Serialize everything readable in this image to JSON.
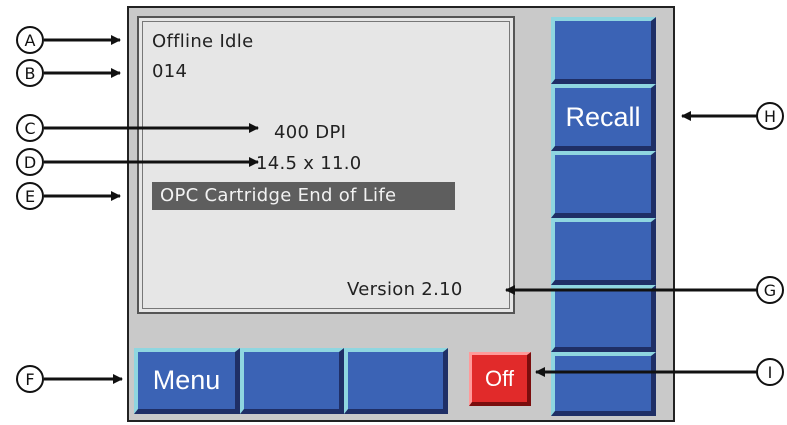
{
  "screen": {
    "status_line1": "Offline Idle",
    "status_line2": "014",
    "resolution": "400 DPI",
    "media_size": "14.5 x 11.0",
    "alert_message": "OPC Cartridge End of Life",
    "version": "Version 2.10"
  },
  "buttons": {
    "menu_label": "Menu",
    "recall_label": "Recall",
    "off_label": "Off"
  },
  "callouts": [
    "A",
    "B",
    "C",
    "D",
    "E",
    "F",
    "G",
    "H",
    "I"
  ],
  "colors": {
    "button_blue": "#3b63b5",
    "button_highlight": "#8fd6e0",
    "off_red": "#e12a2a",
    "alert_bg": "#5e5e5e"
  }
}
